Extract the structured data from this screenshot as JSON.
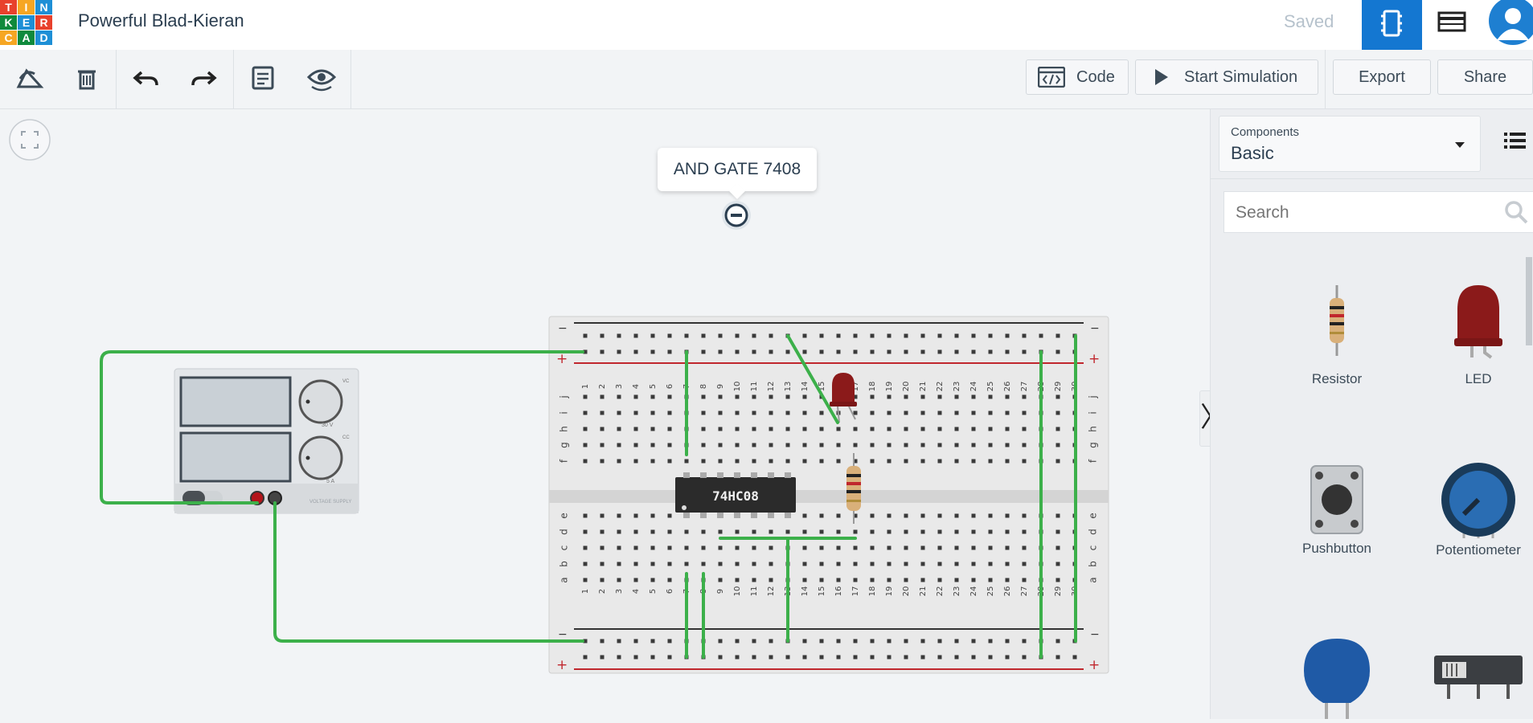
{
  "app": {
    "logo_letters": [
      "T",
      "I",
      "N",
      "K",
      "E",
      "R",
      "C",
      "A",
      "D"
    ],
    "logo_colors": [
      "#e8412c",
      "#f6a623",
      "#1e8fd6",
      "#0f8a3c",
      "#1e8fd6",
      "#e8412c",
      "#f6a623",
      "#0f8a3c",
      "#1e8fd6"
    ],
    "design_title": "Powerful Blad-Kieran",
    "save_status": "Saved"
  },
  "toolbar": {
    "code_label": "Code",
    "simulate_label": "Start Simulation",
    "export_label": "Export",
    "share_label": "Share"
  },
  "canvas": {
    "tooltip_label": "AND GATE 7408",
    "chip_label": "74HC08",
    "supply_label": "VOLTAGE SUPPLY",
    "supply_dial_top": "30 V",
    "supply_dial_bottom": "5 A",
    "supply_vc": "VC",
    "supply_cc": "CC",
    "row_letters_top": [
      "j",
      "i",
      "h",
      "g",
      "f"
    ],
    "row_letters_bottom": [
      "e",
      "d",
      "c",
      "b",
      "a"
    ],
    "column_numbers": [
      "1",
      "2",
      "3",
      "4",
      "5",
      "6",
      "7",
      "8",
      "9",
      "10",
      "11",
      "12",
      "13",
      "14",
      "15",
      "16",
      "17",
      "18",
      "19",
      "20",
      "21",
      "22",
      "23",
      "24",
      "25",
      "26",
      "27",
      "28",
      "29",
      "30"
    ],
    "rail_minus": "−",
    "rail_plus": "+",
    "accent_wire": "#3cb04a",
    "accent_led": "#8b1a1a"
  },
  "sidebar": {
    "components_caption": "Components",
    "components_value": "Basic",
    "search_placeholder": "Search",
    "parts": [
      {
        "label": "Resistor",
        "icon": "resistor-icon"
      },
      {
        "label": "LED",
        "icon": "led-icon"
      },
      {
        "label": "Pushbutton",
        "icon": "pushbutton-icon"
      },
      {
        "label": "Potentiometer",
        "icon": "potentiometer-icon"
      },
      {
        "label": "",
        "icon": "capacitor-icon"
      },
      {
        "label": "",
        "icon": "slideswitch-icon"
      }
    ]
  }
}
